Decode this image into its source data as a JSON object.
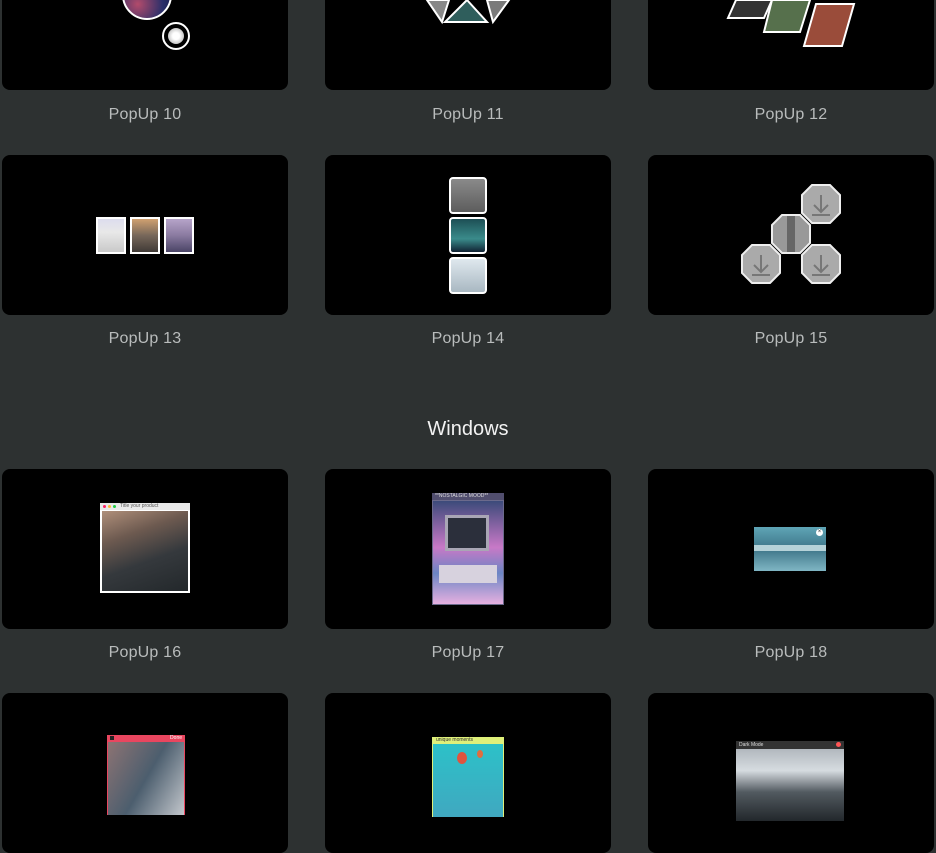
{
  "section_heading": "Windows",
  "cards": [
    {
      "label": "PopUp 10"
    },
    {
      "label": "PopUp 11"
    },
    {
      "label": "PopUp 12"
    },
    {
      "label": "PopUp 13"
    },
    {
      "label": "PopUp 14"
    },
    {
      "label": "PopUp 15"
    },
    {
      "label": "PopUp 16"
    },
    {
      "label": "PopUp 17"
    },
    {
      "label": "PopUp 18"
    }
  ],
  "windows": {
    "w16_title": "Title your product",
    "w17_title": "**NOSTALGIC MOOD**",
    "w19_action": "Done",
    "w20_title": "unique moments",
    "w21_title": "Dark Mode"
  },
  "icons": {
    "download": "download-arrow-icon",
    "close": "close-icon"
  }
}
